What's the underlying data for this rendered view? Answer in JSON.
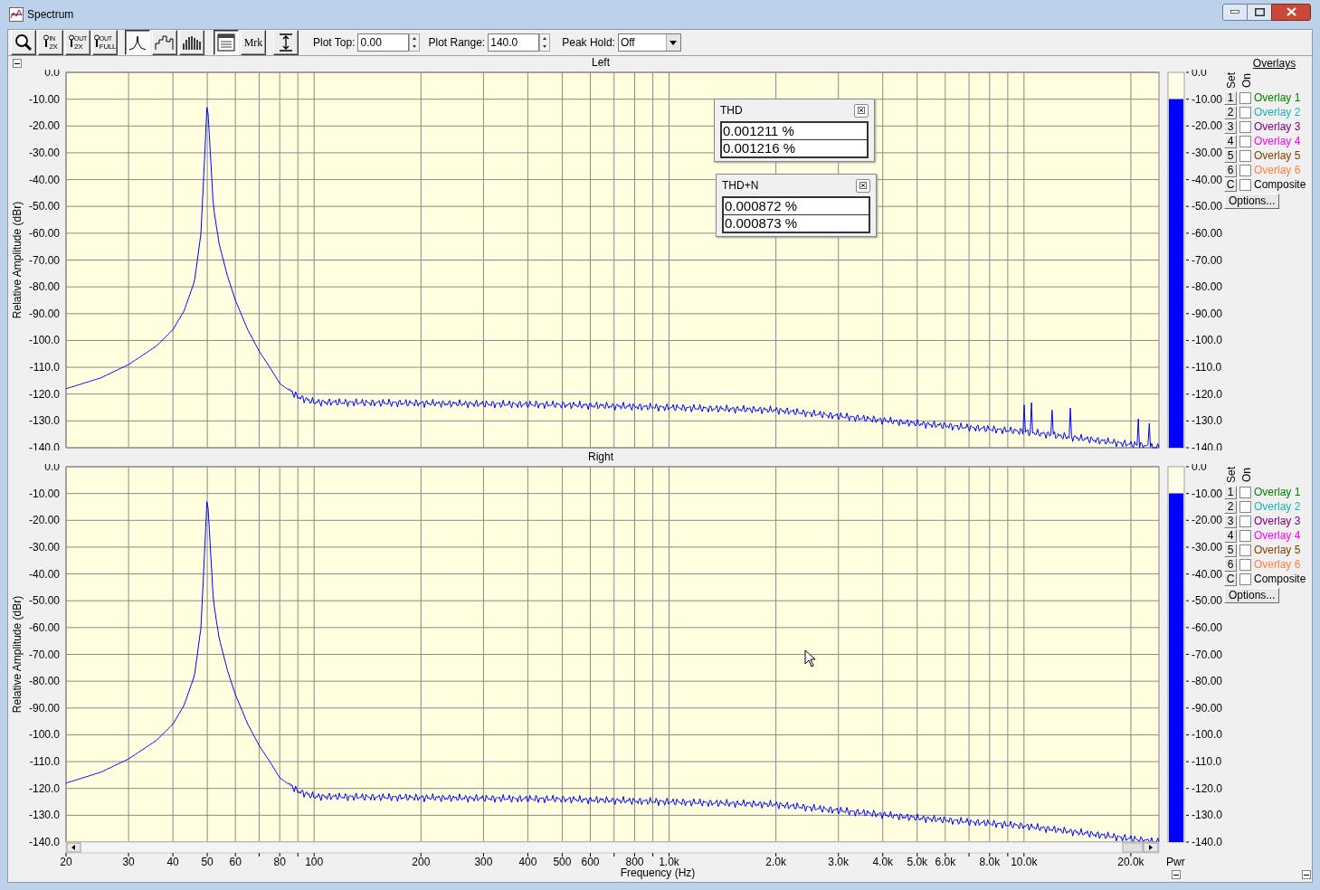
{
  "window": {
    "title": "Spectrum"
  },
  "toolbar": {
    "buttons": [
      {
        "kind": "zoom",
        "pressed": false
      },
      {
        "kind": "zoom_text",
        "top": "IN",
        "bottom": "2X",
        "pressed": false
      },
      {
        "kind": "zoom_text",
        "top": "OUT",
        "bottom": "2X",
        "pressed": false
      },
      {
        "kind": "zoom_text",
        "top": "OUT",
        "bottom": "FULL",
        "pressed": false
      },
      {
        "kind": "line",
        "pressed": true
      },
      {
        "kind": "step",
        "pressed": false
      },
      {
        "kind": "bars",
        "pressed": false
      },
      {
        "kind": "list",
        "pressed": true
      },
      {
        "kind": "text",
        "text": "Mrk",
        "pressed": false
      },
      {
        "kind": "range",
        "pressed": false
      }
    ],
    "plot_top": {
      "label": "Plot Top:",
      "value": "0.00"
    },
    "plot_range": {
      "label": "Plot Range:",
      "value": "140.0"
    },
    "peak_hold": {
      "label": "Peak Hold:",
      "value": "Off"
    }
  },
  "channels": [
    {
      "title": "Left",
      "overlays_header": "Overlays",
      "set_label": "Set",
      "on_label": "On",
      "options": "Options...",
      "y_axis": {
        "label": "Relative Amplitude (dBr)",
        "ticks": [
          "0.0",
          "-10.00",
          "-20.00",
          "-30.00",
          "-40.00",
          "-50.00",
          "-60.00",
          "-70.00",
          "-80.00",
          "-90.00",
          "-100.0",
          "-110.0",
          "-120.0",
          "-130.0",
          "-140.0"
        ]
      },
      "meter": {
        "level": 0.929,
        "ticks": [
          "0.0",
          "-10.00",
          "-20.00",
          "-30.00",
          "-40.00",
          "-50.00",
          "-60.00",
          "-70.00",
          "-80.00",
          "-90.00",
          "-100.0",
          "-110.0",
          "-120.0",
          "-130.0",
          "-140.0"
        ]
      },
      "overlays": [
        {
          "set": "1",
          "label": "Overlay 1",
          "color": "#008000",
          "checked": false
        },
        {
          "set": "2",
          "label": "Overlay 2",
          "color": "#1ab5b5",
          "checked": false
        },
        {
          "set": "3",
          "label": "Overlay 3",
          "color": "#800080",
          "checked": false
        },
        {
          "set": "4",
          "label": "Overlay 4",
          "color": "#ff00ff",
          "checked": false
        },
        {
          "set": "5",
          "label": "Overlay 5",
          "color": "#804000",
          "checked": false
        },
        {
          "set": "6",
          "label": "Overlay 6",
          "color": "#ff8040",
          "checked": false
        },
        {
          "set": "C",
          "label": "Composite",
          "color": "#000000",
          "checked": false
        }
      ]
    },
    {
      "title": "Right",
      "set_label": "Set",
      "on_label": "On",
      "options": "Options...",
      "y_axis": {
        "label": "Relative Amplitude (dBr)",
        "ticks": [
          "0.0",
          "-10.00",
          "-20.00",
          "-30.00",
          "-40.00",
          "-50.00",
          "-60.00",
          "-70.00",
          "-80.00",
          "-90.00",
          "-100.0",
          "-110.0",
          "-120.0",
          "-130.0",
          "-140.0"
        ]
      },
      "x_axis": {
        "label": "Frequency (Hz)",
        "ticks": [
          "20",
          "30",
          "40",
          "50",
          "60",
          "80",
          "100",
          "200",
          "300",
          "400",
          "500",
          "600",
          "800",
          "1.0k",
          "2.0k",
          "3.0k",
          "4.0k",
          "5.0k",
          "6.0k",
          "8.0k",
          "10.0k",
          "20.0k"
        ]
      },
      "meter": {
        "level": 0.929,
        "ticks": [
          "0.0",
          "-10.00",
          "-20.00",
          "-30.00",
          "-40.00",
          "-50.00",
          "-60.00",
          "-70.00",
          "-80.00",
          "-90.00",
          "-100.0",
          "-110.0",
          "-120.0",
          "-130.0",
          "-140.0"
        ],
        "label": "Pwr"
      },
      "overlays": [
        {
          "set": "1",
          "label": "Overlay 1",
          "color": "#008000",
          "checked": false
        },
        {
          "set": "2",
          "label": "Overlay 2",
          "color": "#1ab5b5",
          "checked": false
        },
        {
          "set": "3",
          "label": "Overlay 3",
          "color": "#800080",
          "checked": false
        },
        {
          "set": "4",
          "label": "Overlay 4",
          "color": "#ff00ff",
          "checked": false
        },
        {
          "set": "5",
          "label": "Overlay 5",
          "color": "#804000",
          "checked": false
        },
        {
          "set": "6",
          "label": "Overlay 6",
          "color": "#ff8040",
          "checked": false
        },
        {
          "set": "C",
          "label": "Composite",
          "color": "#000000",
          "checked": false
        }
      ]
    }
  ],
  "readouts": [
    {
      "title": "THD",
      "values": [
        "0.001211 %",
        "0.001216 %"
      ]
    },
    {
      "title": "THD+N",
      "values": [
        "0.000872 %",
        "0.000873 %"
      ]
    }
  ]
}
